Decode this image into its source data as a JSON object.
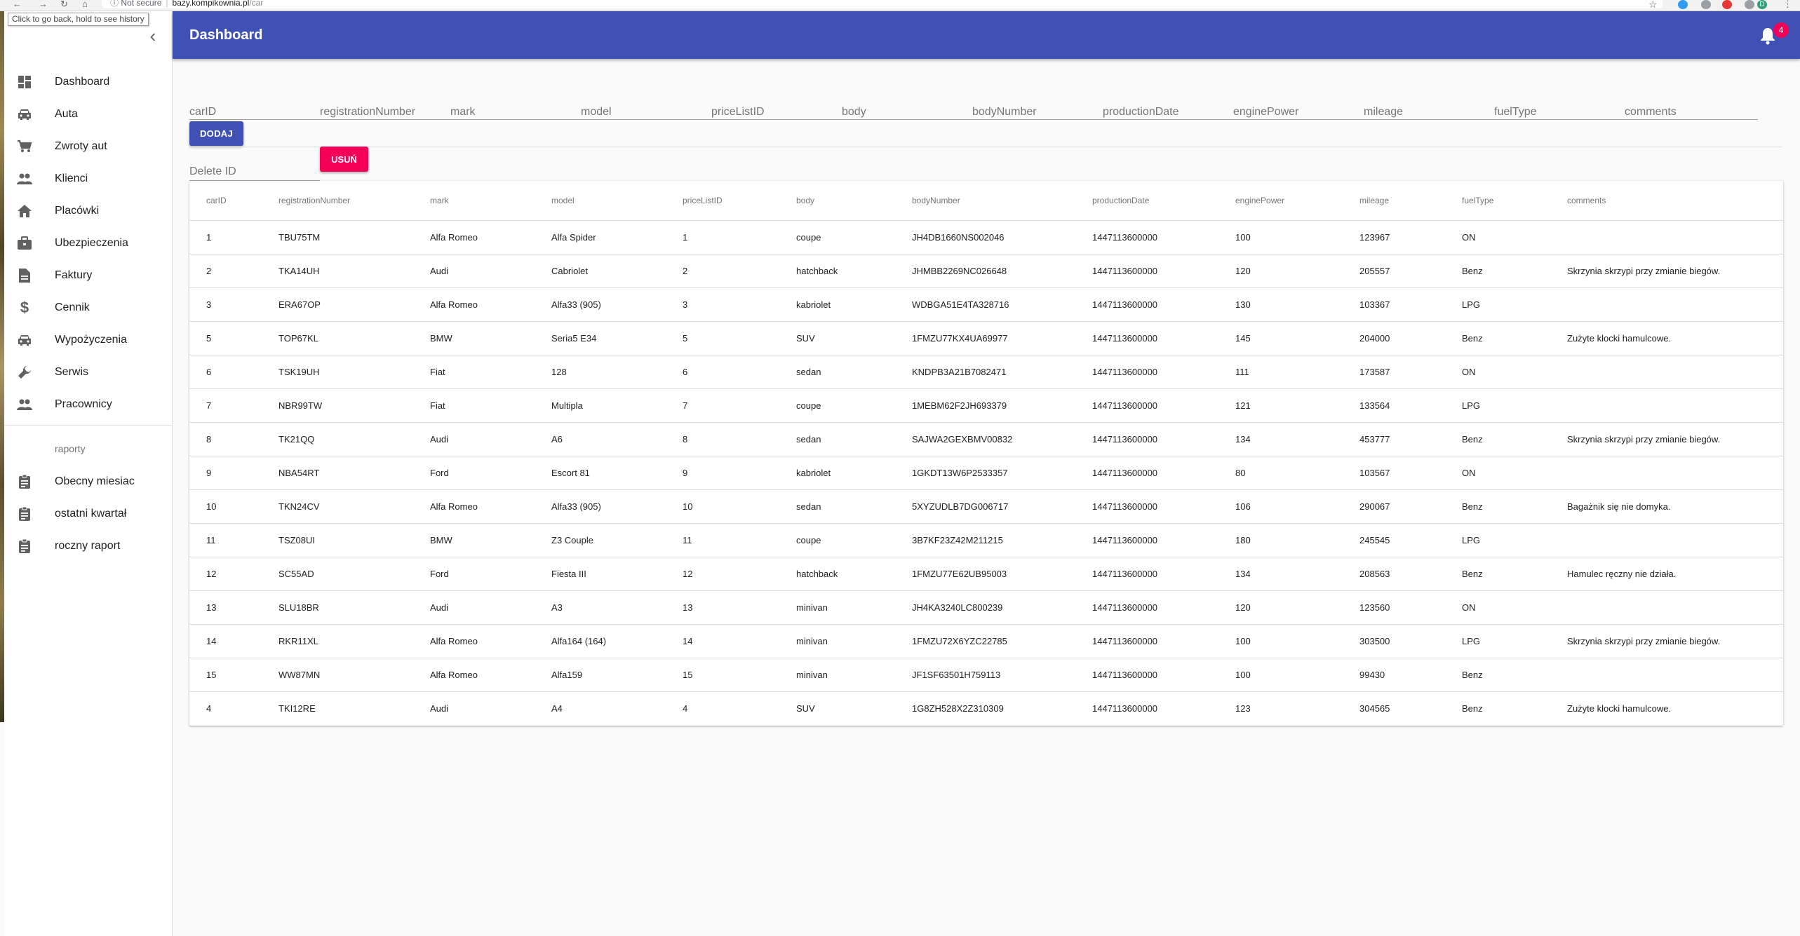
{
  "browser": {
    "security": "Not secure",
    "host": "bazy.kompikownia.pl",
    "path": "/car",
    "tooltip": "Click to go back, hold to see history"
  },
  "appbar": {
    "title": "Dashboard",
    "notification_count": "4"
  },
  "sidebar": {
    "items": [
      {
        "label": "Dashboard",
        "icon": "dashboard-icon"
      },
      {
        "label": "Auta",
        "icon": "car-icon"
      },
      {
        "label": "Zwroty aut",
        "icon": "cart-icon"
      },
      {
        "label": "Klienci",
        "icon": "people-icon"
      },
      {
        "label": "Placówki",
        "icon": "home-icon"
      },
      {
        "label": "Ubezpieczenia",
        "icon": "briefcase-icon"
      },
      {
        "label": "Faktury",
        "icon": "document-icon"
      },
      {
        "label": "Cennik",
        "icon": "dollar-icon"
      },
      {
        "label": "Wypożyczenia",
        "icon": "car-icon"
      },
      {
        "label": "Serwis",
        "icon": "wrench-icon"
      },
      {
        "label": "Pracownicy",
        "icon": "people-icon"
      }
    ],
    "reports_header": "raporty",
    "reports": [
      {
        "label": "Obecny miesiac",
        "icon": "clipboard-icon"
      },
      {
        "label": "ostatni kwartał",
        "icon": "clipboard-icon"
      },
      {
        "label": "roczny raport",
        "icon": "clipboard-icon"
      }
    ]
  },
  "form": {
    "fields": [
      "carID",
      "registrationNumber",
      "mark",
      "model",
      "priceListID",
      "body",
      "bodyNumber",
      "productionDate",
      "enginePower",
      "mileage",
      "fuelType",
      "comments"
    ],
    "add_label": "DODAJ",
    "delete_placeholder": "Delete ID",
    "delete_label": "USUŃ"
  },
  "table": {
    "columns": [
      "carID",
      "registrationNumber",
      "mark",
      "model",
      "priceListID",
      "body",
      "bodyNumber",
      "productionDate",
      "enginePower",
      "mileage",
      "fuelType",
      "comments"
    ],
    "rows": [
      [
        "1",
        "TBU75TM",
        "Alfa Romeo",
        "Alfa Spider",
        "1",
        "coupe",
        "JH4DB1660NS002046",
        "1447113600000",
        "100",
        "123967",
        "ON",
        ""
      ],
      [
        "2",
        "TKA14UH",
        "Audi",
        "Cabriolet",
        "2",
        "hatchback",
        "JHMBB2269NC026648",
        "1447113600000",
        "120",
        "205557",
        "Benz",
        "Skrzynia skrzypi przy zmianie biegów."
      ],
      [
        "3",
        "ERA67OP",
        "Alfa Romeo",
        "Alfa33 (905)",
        "3",
        "kabriolet",
        "WDBGA51E4TA328716",
        "1447113600000",
        "130",
        "103367",
        "LPG",
        ""
      ],
      [
        "5",
        "TOP67KL",
        "BMW",
        "Seria5 E34",
        "5",
        "SUV",
        "1FMZU77KX4UA69977",
        "1447113600000",
        "145",
        "204000",
        "Benz",
        "Zużyte klocki hamulcowe."
      ],
      [
        "6",
        "TSK19UH",
        "Fiat",
        "128",
        "6",
        "sedan",
        "KNDPB3A21B7082471",
        "1447113600000",
        "111",
        "173587",
        "ON",
        ""
      ],
      [
        "7",
        "NBR99TW",
        "Fiat",
        "Multipla",
        "7",
        "coupe",
        "1MEBM62F2JH693379",
        "1447113600000",
        "121",
        "133564",
        "LPG",
        ""
      ],
      [
        "8",
        "TK21QQ",
        "Audi",
        "A6",
        "8",
        "sedan",
        "SAJWA2GEXBMV00832",
        "1447113600000",
        "134",
        "453777",
        "Benz",
        "Skrzynia skrzypi przy zmianie biegów."
      ],
      [
        "9",
        "NBA54RT",
        "Ford",
        "Escort 81",
        "9",
        "kabriolet",
        "1GKDT13W6P2533357",
        "1447113600000",
        "80",
        "103567",
        "ON",
        ""
      ],
      [
        "10",
        "TKN24CV",
        "Alfa Romeo",
        "Alfa33 (905)",
        "10",
        "sedan",
        "5XYZUDLB7DG006717",
        "1447113600000",
        "106",
        "290067",
        "Benz",
        "Bagażnik się nie domyka."
      ],
      [
        "11",
        "TSZ08UI",
        "BMW",
        "Z3 Couple",
        "11",
        "coupe",
        "3B7KF23Z42M211215",
        "1447113600000",
        "180",
        "245545",
        "LPG",
        ""
      ],
      [
        "12",
        "SC55AD",
        "Ford",
        "Fiesta III",
        "12",
        "hatchback",
        "1FMZU77E62UB95003",
        "1447113600000",
        "134",
        "208563",
        "Benz",
        "Hamulec ręczny nie działa."
      ],
      [
        "13",
        "SLU18BR",
        "Audi",
        "A3",
        "13",
        "minivan",
        "JH4KA3240LC800239",
        "1447113600000",
        "120",
        "123560",
        "ON",
        ""
      ],
      [
        "14",
        "RKR11XL",
        "Alfa Romeo",
        "Alfa164 (164)",
        "14",
        "minivan",
        "1FMZU72X6YZC22785",
        "1447113600000",
        "100",
        "303500",
        "LPG",
        "Skrzynia skrzypi przy zmianie biegów."
      ],
      [
        "15",
        "WW87MN",
        "Alfa Romeo",
        "Alfa159",
        "15",
        "minivan",
        "JF1SF63501H759113",
        "1447113600000",
        "100",
        "99430",
        "Benz",
        ""
      ],
      [
        "4",
        "TKI12RE",
        "Audi",
        "A4",
        "4",
        "SUV",
        "1G8ZH528X2Z310309",
        "1447113600000",
        "123",
        "304565",
        "Benz",
        "Zużyte klocki hamulcowe."
      ]
    ]
  },
  "colors": {
    "primary": "#3f51b5",
    "secondary": "#f50057"
  }
}
